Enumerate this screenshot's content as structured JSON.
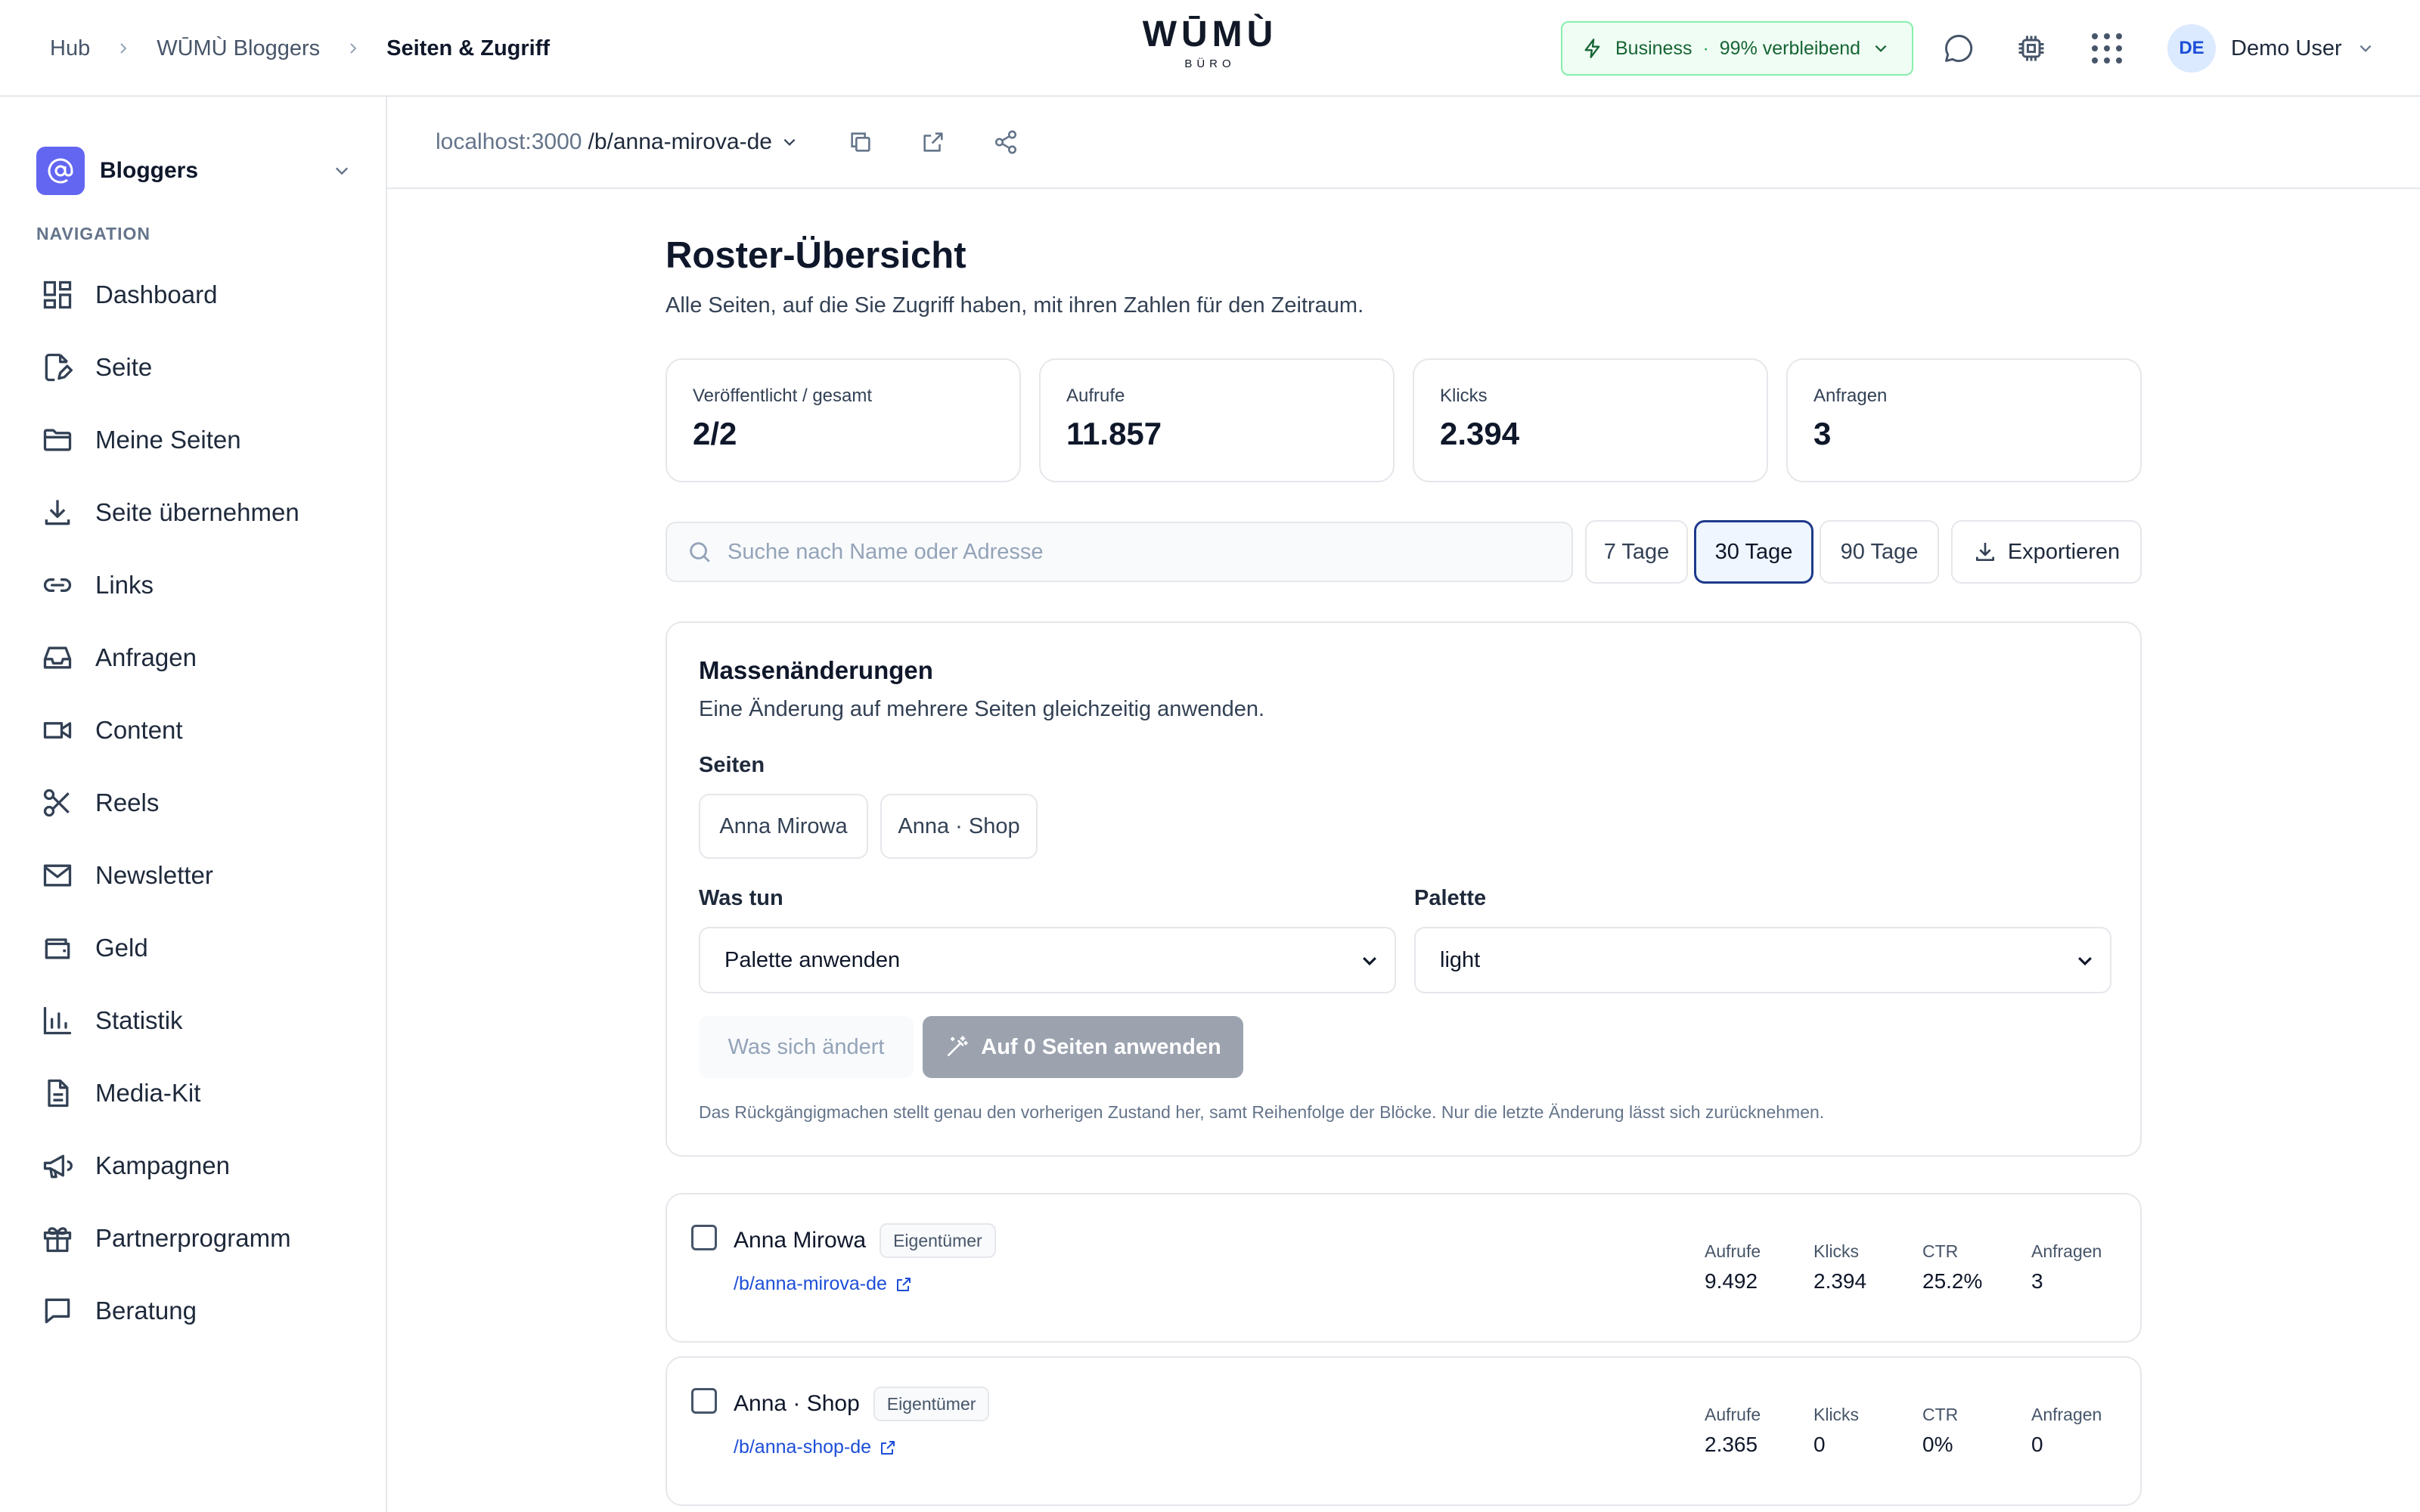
{
  "breadcrumb": [
    "Hub",
    "WŪMÙ Bloggers",
    "Seiten & Zugriff"
  ],
  "logo": {
    "word": "WŪMÙ",
    "sub": "BÜRO"
  },
  "plan": {
    "name": "Business",
    "separator": "·",
    "remaining": "99% verbleibend"
  },
  "user": {
    "initials": "DE",
    "name": "Demo User"
  },
  "workspace": {
    "name": "Bloggers"
  },
  "nav": {
    "heading": "NAVIGATION",
    "items": [
      {
        "label": "Dashboard",
        "icon": "dashboard-icon"
      },
      {
        "label": "Seite",
        "icon": "page-edit-icon"
      },
      {
        "label": "Meine Seiten",
        "icon": "folder-icon"
      },
      {
        "label": "Seite übernehmen",
        "icon": "download-icon"
      },
      {
        "label": "Links",
        "icon": "link-icon"
      },
      {
        "label": "Anfragen",
        "icon": "inbox-icon"
      },
      {
        "label": "Content",
        "icon": "video-icon"
      },
      {
        "label": "Reels",
        "icon": "scissors-icon"
      },
      {
        "label": "Newsletter",
        "icon": "mail-icon"
      },
      {
        "label": "Geld",
        "icon": "wallet-icon"
      },
      {
        "label": "Statistik",
        "icon": "bar-chart-icon"
      },
      {
        "label": "Media-Kit",
        "icon": "document-icon"
      },
      {
        "label": "Kampagnen",
        "icon": "megaphone-icon"
      },
      {
        "label": "Partnerprogramm",
        "icon": "gift-icon"
      },
      {
        "label": "Beratung",
        "icon": "chat-icon"
      }
    ]
  },
  "url": {
    "host": "localhost:3000",
    "path": "/b/anna-mirova-de"
  },
  "main": {
    "title": "Roster-Übersicht",
    "subtitle": "Alle Seiten, auf die Sie Zugriff haben, mit ihren Zahlen für den Zeitraum."
  },
  "stats": [
    {
      "label": "Veröffentlicht / gesamt",
      "value": "2/2"
    },
    {
      "label": "Aufrufe",
      "value": "11.857"
    },
    {
      "label": "Klicks",
      "value": "2.394"
    },
    {
      "label": "Anfragen",
      "value": "3"
    }
  ],
  "search": {
    "placeholder": "Suche nach Name oder Adresse",
    "value": ""
  },
  "ranges": {
    "d7": "7 Tage",
    "d30": "30 Tage",
    "d90": "90 Tage",
    "selected": "30 Tage"
  },
  "export_label": "Exportieren",
  "bulk": {
    "title": "Massenänderungen",
    "description": "Eine Änderung auf mehrere Seiten gleichzeitig anwenden.",
    "pages_label": "Seiten",
    "page_chips": [
      "Anna Mirowa",
      "Anna · Shop"
    ],
    "action_label": "Was tun",
    "action_value": "Palette anwenden",
    "palette_label": "Palette",
    "palette_value": "light",
    "preview_label": "Was sich ändert",
    "apply_label": "Auf 0 Seiten anwenden",
    "note": "Das Rückgängigmachen stellt genau den vorherigen Zustand her, samt Reihenfolge der Blöcke. Nur die letzte Änderung lässt sich zurücknehmen."
  },
  "pages": [
    {
      "name": "Anna Mirowa",
      "role": "Eigentümer",
      "link": "/b/anna-mirova-de",
      "metrics": [
        {
          "label": "Aufrufe",
          "value": "9.492"
        },
        {
          "label": "Klicks",
          "value": "2.394"
        },
        {
          "label": "CTR",
          "value": "25.2%"
        },
        {
          "label": "Anfragen",
          "value": "3"
        }
      ]
    },
    {
      "name": "Anna · Shop",
      "role": "Eigentümer",
      "link": "/b/anna-shop-de",
      "metrics": [
        {
          "label": "Aufrufe",
          "value": "2.365"
        },
        {
          "label": "Klicks",
          "value": "0"
        },
        {
          "label": "CTR",
          "value": "0%"
        },
        {
          "label": "Anfragen",
          "value": "0"
        }
      ]
    }
  ],
  "colors": {
    "accent": "#6366f1",
    "plan_green": "#166534",
    "link_blue": "#1d4ed8",
    "active_range_border": "#1e3a8a"
  }
}
